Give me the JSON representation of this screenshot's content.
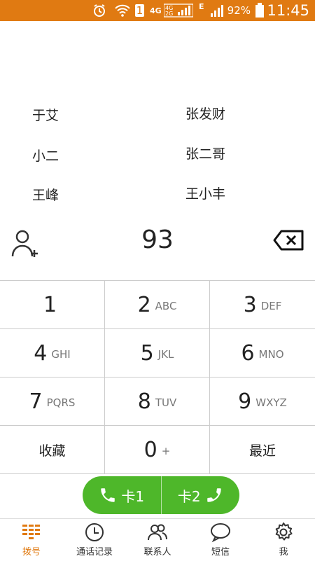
{
  "status_bar": {
    "sim": "1",
    "network_1": "4G",
    "network_2": "4G\n2G",
    "network_e": "E",
    "battery_pct": "92%",
    "time": "11:45",
    "accent": "#e07a12"
  },
  "suggestions": [
    "于艾",
    "张发财",
    "小二",
    "张二哥",
    "王峰",
    "王小丰"
  ],
  "input": {
    "number": "93"
  },
  "keys": [
    {
      "digit": "1",
      "letters": ""
    },
    {
      "digit": "2",
      "letters": "ABC"
    },
    {
      "digit": "3",
      "letters": "DEF"
    },
    {
      "digit": "4",
      "letters": "GHI"
    },
    {
      "digit": "5",
      "letters": "JKL"
    },
    {
      "digit": "6",
      "letters": "MNO"
    },
    {
      "digit": "7",
      "letters": "PQRS"
    },
    {
      "digit": "8",
      "letters": "TUV"
    },
    {
      "digit": "9",
      "letters": "WXYZ"
    },
    {
      "digit": "收藏",
      "letters": ""
    },
    {
      "digit": "0",
      "letters": "+"
    },
    {
      "digit": "最近",
      "letters": ""
    }
  ],
  "call": {
    "card1": "卡1",
    "card2": "卡2",
    "color": "#4eb72a"
  },
  "nav": [
    {
      "label": "拨号",
      "icon": "dialpad-icon",
      "active": true
    },
    {
      "label": "通话记录",
      "icon": "clock-icon",
      "active": false
    },
    {
      "label": "联系人",
      "icon": "contacts-icon",
      "active": false
    },
    {
      "label": "短信",
      "icon": "message-icon",
      "active": false
    },
    {
      "label": "我",
      "icon": "gear-icon",
      "active": false
    }
  ]
}
